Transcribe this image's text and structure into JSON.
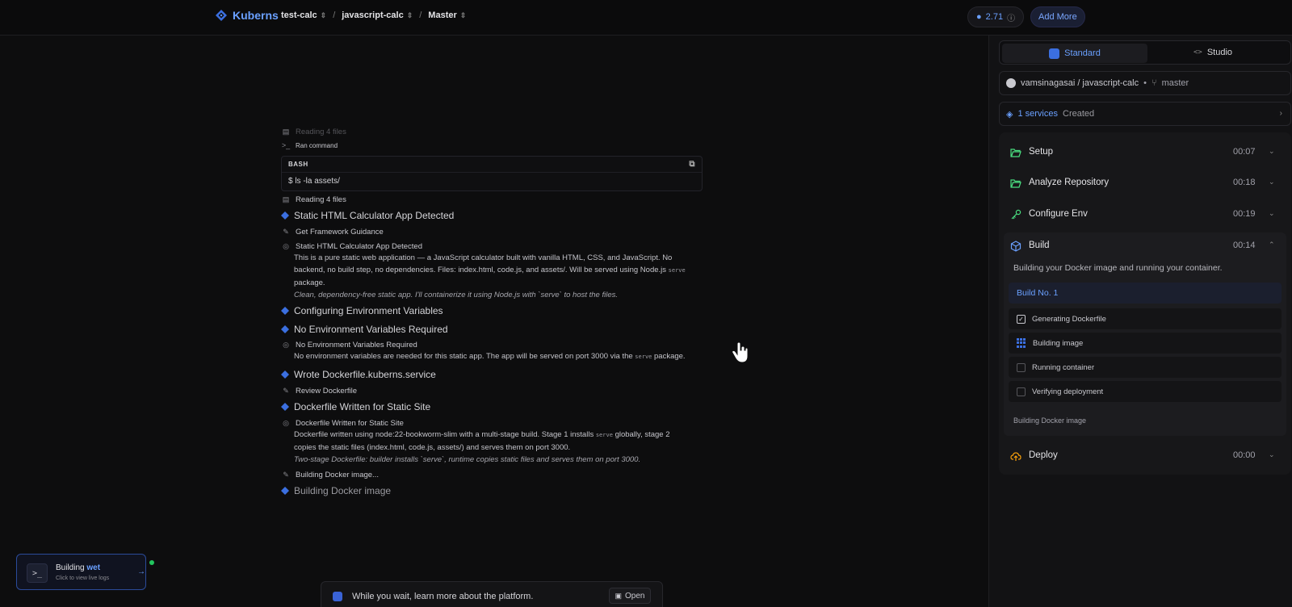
{
  "header": {
    "brand": "Kuberns",
    "breadcrumbs": [
      "test-calc",
      "javascript-calc",
      "Master"
    ],
    "credits": "2.71",
    "add_more": "Add More"
  },
  "feed": {
    "dim_top": "Reading 4 files",
    "run_command": "Ran command",
    "bash": {
      "label": "BASH",
      "command": "$ ls -la assets/"
    },
    "items": {
      "reading": "Reading 4 files",
      "static_detected_title": "Static HTML Calculator App Detected",
      "get_guidance": "Get Framework Guidance",
      "static_detected_sub": "Static HTML Calculator App Detected",
      "static_para_1": "This is a pure static web application — a JavaScript calculator built with vanilla HTML, CSS, and JavaScript. No",
      "static_para_2": "backend, no build step, no dependencies. Files: index.html, code.js, and assets/. Will be served using Node.js",
      "static_para_2_code": "serve",
      "static_para_3": "package.",
      "static_italic": "Clean, dependency-free static app. I'll containerize it using Node.js with `serve` to host the files.",
      "configuring_env": "Configuring Environment Variables",
      "no_env_title": "No Environment Variables Required",
      "no_env_sub": "No Environment Variables Required",
      "no_env_para": "No environment variables are needed for this static app. The app will be served on port 3000 via the",
      "no_env_code": "serve",
      "no_env_para_end": "package.",
      "wrote_dockerfile": "Wrote Dockerfile.kuberns.service",
      "review_dockerfile": "Review Dockerfile",
      "dockerfile_written_title": "Dockerfile Written for Static Site",
      "dockerfile_written_sub": "Dockerfile Written for Static Site",
      "dockerfile_para_1a": "Dockerfile written using node:22-bookworm-slim with a multi-stage build. Stage 1 installs",
      "dockerfile_para_1_code": "serve",
      "dockerfile_para_1b": "globally, stage 2",
      "dockerfile_para_2": "copies the static files (index.html, code.js, assets/) and serves them on port 3000.",
      "dockerfile_italic": "Two-stage Dockerfile: builder installs `serve`, runtime copies static files and serves them on port 3000.",
      "building_docker_dots": "Building Docker image...",
      "building_docker": "Building Docker image"
    }
  },
  "toast": {
    "title": "Building",
    "highlight": "wet",
    "subtitle": "Click to view live logs"
  },
  "banner": {
    "text": "While you wait, learn more about the platform.",
    "open": "Open"
  },
  "panel": {
    "tabs": {
      "standard": "Standard",
      "studio": "Studio"
    },
    "repo": {
      "path": "vamsinagasai / javascript-calc",
      "separator": "•",
      "branch": "master"
    },
    "services": {
      "count": "1 services",
      "status": "Created"
    },
    "steps": [
      {
        "label": "Setup",
        "time": "00:07"
      },
      {
        "label": "Analyze Repository",
        "time": "00:18"
      },
      {
        "label": "Configure Env",
        "time": "00:19"
      },
      {
        "label": "Build",
        "time": "00:14"
      },
      {
        "label": "Deploy",
        "time": "00:00"
      }
    ],
    "build": {
      "description": "Building your Docker image and running your container.",
      "build_no": "Build No. 1",
      "substeps": [
        {
          "label": "Generating Dockerfile",
          "state": "done"
        },
        {
          "label": "Building image",
          "state": "in-progress"
        },
        {
          "label": "Running container",
          "state": "pending"
        },
        {
          "label": "Verifying deployment",
          "state": "pending"
        }
      ],
      "status": "Building Docker image"
    }
  },
  "colors": {
    "accent": "#6aa0ff",
    "success": "#22c55e",
    "folder": "#4ade80",
    "deploy": "#f59e0b"
  }
}
